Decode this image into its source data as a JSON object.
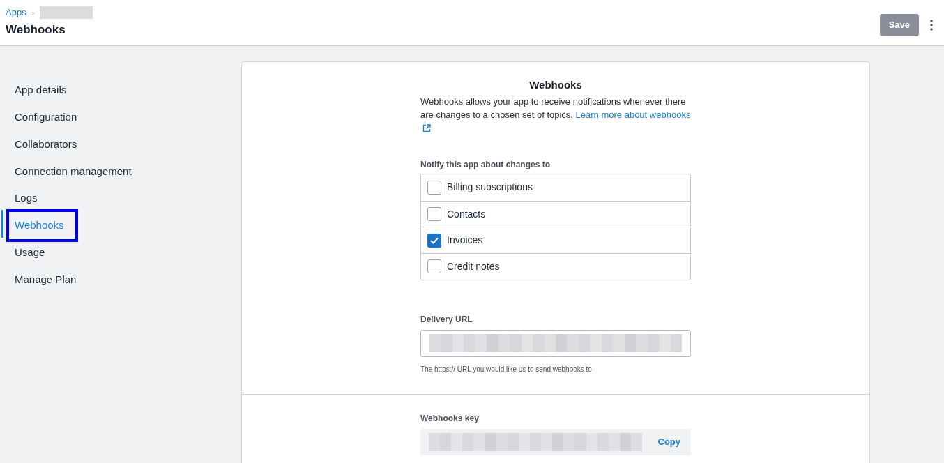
{
  "breadcrumb": {
    "items": [
      "Apps"
    ],
    "separator": "›",
    "redacted": true
  },
  "page_title": "Webhooks",
  "header_actions": {
    "save": {
      "label": "Save",
      "disabled": true
    }
  },
  "sidebar": {
    "items": [
      {
        "label": "App details",
        "selected": false,
        "highlighted": false
      },
      {
        "label": "Configuration",
        "selected": false,
        "highlighted": false
      },
      {
        "label": "Collaborators",
        "selected": false,
        "highlighted": false
      },
      {
        "label": "Connection management",
        "selected": false,
        "highlighted": false
      },
      {
        "label": "Logs",
        "selected": false,
        "highlighted": false
      },
      {
        "label": "Webhooks",
        "selected": true,
        "highlighted": true
      },
      {
        "label": "Usage",
        "selected": false,
        "highlighted": false
      },
      {
        "label": "Manage Plan",
        "selected": false,
        "highlighted": false
      }
    ]
  },
  "card": {
    "title": "Webhooks",
    "description": "Webhooks allows your app to receive notifications whenever there are changes to a chosen set of topics.",
    "link": "Learn more about webhooks",
    "topics_label": "Notify this app about changes to",
    "topics": [
      {
        "label": "Billing subscriptions",
        "checked": false
      },
      {
        "label": "Contacts",
        "checked": false
      },
      {
        "label": "Invoices",
        "checked": true
      },
      {
        "label": "Credit notes",
        "checked": false
      }
    ],
    "delivery_url": {
      "label": "Delivery URL",
      "redacted": true,
      "help": "The https:// URL you would like us to send webhooks to"
    },
    "key": {
      "label": "Webhooks key",
      "redacted": true,
      "copy": "Copy"
    }
  }
}
